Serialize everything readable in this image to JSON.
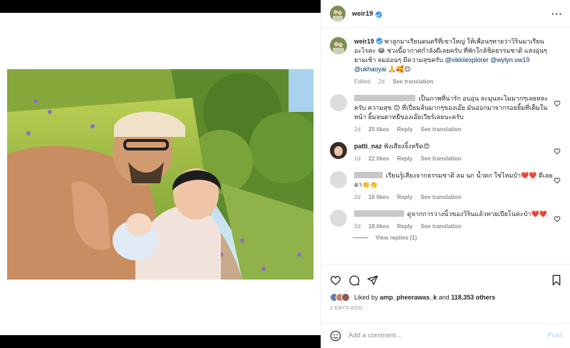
{
  "post": {
    "username": "weir19",
    "caption_text": "พาลูกมาเรียนดนตรีที่เขาใหญ่ ให้เพื่อนๆทายว่าวิรินมาเรียน อะไรคะ 😂 ช่วงนี้อากาศกำลังดีเลยครับ ที่พักใกล้ชิดธรรมชาติ แสงอุ่นๆ ยามเช้า ลมอ่อนๆ มีความสุขครับ",
    "mentions": "@vikkiiexplorer @wylyn.vw19 @ukhaoyai",
    "caption_tail": "🙏🥰😊",
    "edited": "Edited",
    "time": "2d",
    "see_translation": "See translation"
  },
  "comments": [
    {
      "text": "เป็นภาพที่น่ารัก อบอุ่น ละมุนละไมมากๆเลยหละครับ ความสุข 😊 ที่เปี่ยมล้นมากๆของเอ๊ย มันออกมาจากรอยยิ้มที่เต็มในหน้า ยิ้มจนตาหยีของเอ๊ยเวียร์เลยนะครับ",
      "time": "2d",
      "likes": "25 likes",
      "reply": "Reply",
      "translate": "See translation"
    },
    {
      "author": "patti_naz",
      "text": "ฟังเสียงจิ้งหรีด😍",
      "time": "1d",
      "likes": "22 likes",
      "reply": "Reply",
      "translate": "See translation"
    },
    {
      "text": "เรียนรู้เสียงจากธรรมชาติ ลม นก น้ำตก ใช่ไหมป๋า❤️❤️ ดีเลยค่า👏👏",
      "time": "2d",
      "likes": "16 likes",
      "reply": "Reply",
      "translate": "See translation"
    },
    {
      "text": "ดูจากการวางนิ้วของวิรินแล้วทายเปียโนค่ะป๋า❤️❤️",
      "time": "2d",
      "likes": "18 likes",
      "reply": "Reply",
      "translate": "See translation"
    }
  ],
  "view_replies": "View replies (1)",
  "likes": {
    "prefix": "Liked by ",
    "user": "amp_pheerawas_k",
    "middle": " and ",
    "others": "118,353 others"
  },
  "ago": "2 DAYS AGO",
  "add_comment": {
    "placeholder": "Add a comment...",
    "post_label": "Post"
  },
  "icons": [
    "more-options-icon",
    "heart-icon",
    "comment-icon",
    "share-icon",
    "bookmark-icon",
    "emoji-icon",
    "verified-badge-icon"
  ],
  "colors": {
    "verified": "#3897f0",
    "link": "#00376b",
    "muted": "#8e8e8e",
    "post_button": "#b2dffc"
  }
}
